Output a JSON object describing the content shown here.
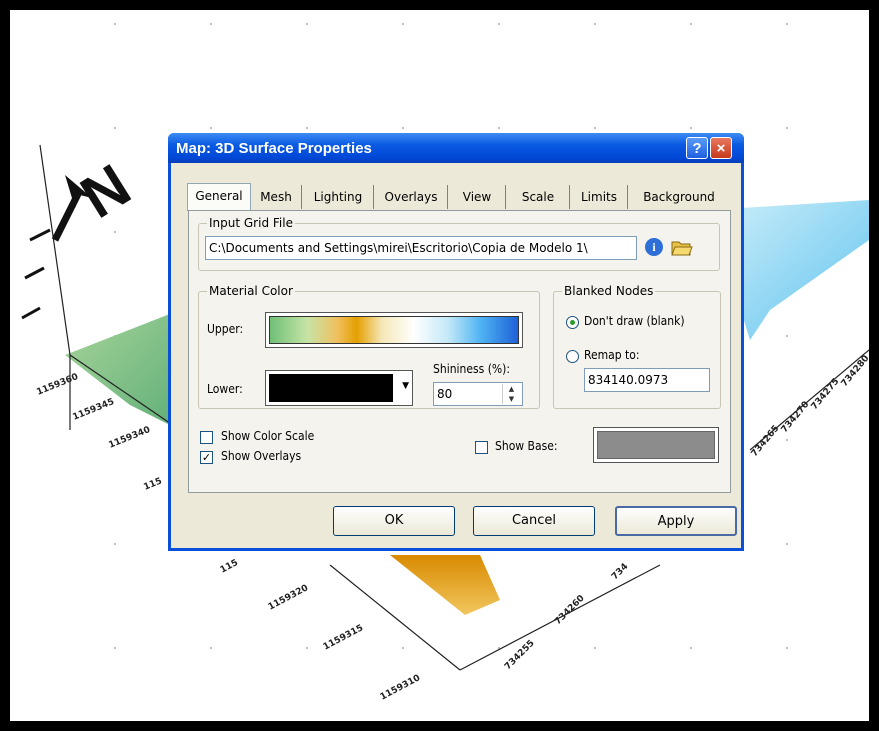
{
  "compass_label": "N",
  "axis_ticks": {
    "left": [
      "1159360",
      "1159345",
      "1159340",
      "115"
    ],
    "front_y": [
      "115",
      "1159320",
      "1159315",
      "1159310"
    ],
    "front_x": [
      "734255",
      "734260",
      "734"
    ],
    "right": [
      "734265",
      "734270",
      "734275",
      "734280"
    ]
  },
  "dialog": {
    "title": "Map: 3D Surface Properties",
    "help_glyph": "?",
    "close_glyph": "×",
    "tabs": [
      "General",
      "Mesh",
      "Lighting",
      "Overlays",
      "View",
      "Scale",
      "Limits",
      "Background"
    ],
    "active_tab": "General",
    "input_grid": {
      "legend": "Input Grid File",
      "path": "C:\\Documents and Settings\\mirei\\Escritorio\\Copia de Modelo 1\\",
      "info_icon": "info-icon",
      "open_icon": "open-folder-icon"
    },
    "material_color": {
      "legend": "Material Color",
      "upper_label": "Upper:",
      "lower_label": "Lower:",
      "lower_color": "#000000",
      "shininess_label": "Shininess (%):",
      "shininess_value": "80"
    },
    "blanked_nodes": {
      "legend": "Blanked Nodes",
      "dont_draw_label": "Don't draw (blank)",
      "dont_draw_selected": true,
      "remap_label": "Remap to:",
      "remap_value": "834140.0973"
    },
    "show_color_scale_label": "Show Color Scale",
    "show_color_scale_checked": false,
    "show_overlays_label": "Show Overlays",
    "show_overlays_checked": true,
    "show_base_label": "Show Base:",
    "show_base_checked": false,
    "base_color": "#8c8c8c",
    "buttons": {
      "ok": "OK",
      "cancel": "Cancel",
      "apply": "Apply"
    }
  }
}
